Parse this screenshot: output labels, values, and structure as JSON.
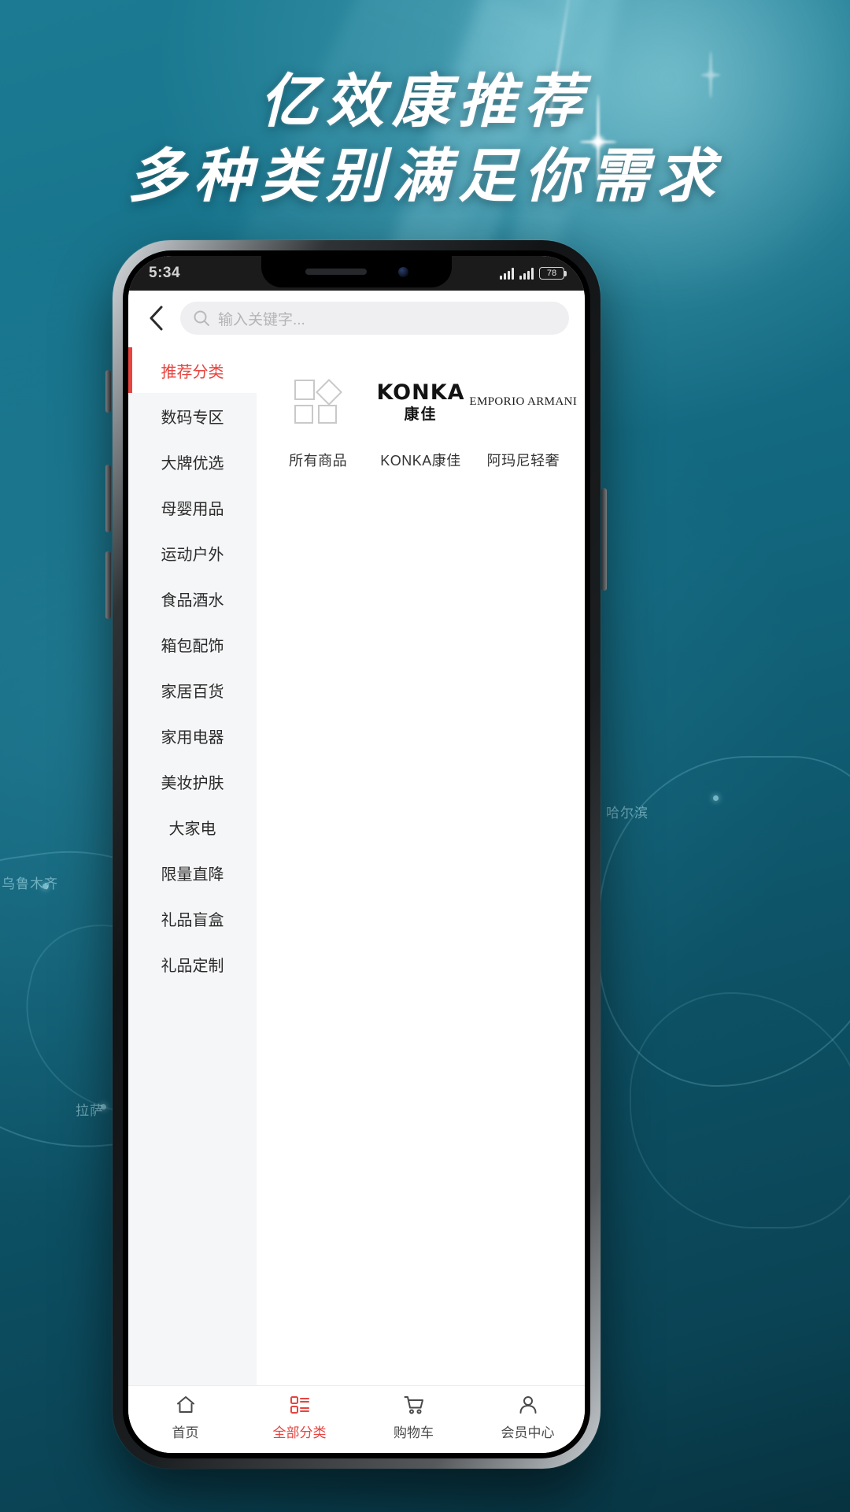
{
  "poster": {
    "headline_line1": "亿效康推荐",
    "headline_line2": "多种类别满足你需求",
    "map_labels": [
      "哈尔滨",
      "乌鲁木齐",
      "拉萨"
    ],
    "bg_accent": "#12677e",
    "headline_color": "#ffffff"
  },
  "statusbar": {
    "time": "5:34",
    "battery_level": "78",
    "signal_icon": "signal-bars-icon",
    "wifi_icon": "wifi-icon",
    "battery_icon": "battery-icon"
  },
  "search": {
    "back_icon": "chevron-left-icon",
    "search_icon": "search-icon",
    "placeholder": "输入关键字...",
    "value": ""
  },
  "sidebar": {
    "items": [
      {
        "label": "推荐分类",
        "active": true
      },
      {
        "label": "数码专区",
        "active": false
      },
      {
        "label": "大牌优选",
        "active": false
      },
      {
        "label": "母婴用品",
        "active": false
      },
      {
        "label": "运动户外",
        "active": false
      },
      {
        "label": "食品酒水",
        "active": false
      },
      {
        "label": "箱包配饰",
        "active": false
      },
      {
        "label": "家居百货",
        "active": false
      },
      {
        "label": "家用电器",
        "active": false
      },
      {
        "label": "美妆护肤",
        "active": false
      },
      {
        "label": "大家电",
        "active": false
      },
      {
        "label": "限量直降",
        "active": false
      },
      {
        "label": "礼品盲盒",
        "active": false
      },
      {
        "label": "礼品定制",
        "active": false
      }
    ],
    "active_color": "#e8433f",
    "bg_color": "#f5f6f7"
  },
  "brands": [
    {
      "name": "所有商品",
      "logo_type": "placeholder-shapes",
      "logo_icon": "shapes-placeholder-icon"
    },
    {
      "name": "KONKA康佳",
      "logo_type": "konka",
      "logo_en": "KONKA",
      "logo_cn": "康佳"
    },
    {
      "name": "阿玛尼轻奢",
      "logo_type": "armani",
      "logo_en": "EMPORIO ARMANI"
    }
  ],
  "tabbar": {
    "items": [
      {
        "label": "首页",
        "icon": "home-icon",
        "active": false
      },
      {
        "label": "全部分类",
        "icon": "grid-list-icon",
        "active": true
      },
      {
        "label": "购物车",
        "icon": "cart-icon",
        "active": false
      },
      {
        "label": "会员中心",
        "icon": "user-icon",
        "active": false
      }
    ],
    "active_color": "#e8433f",
    "inactive_color": "#4a4a4a"
  }
}
